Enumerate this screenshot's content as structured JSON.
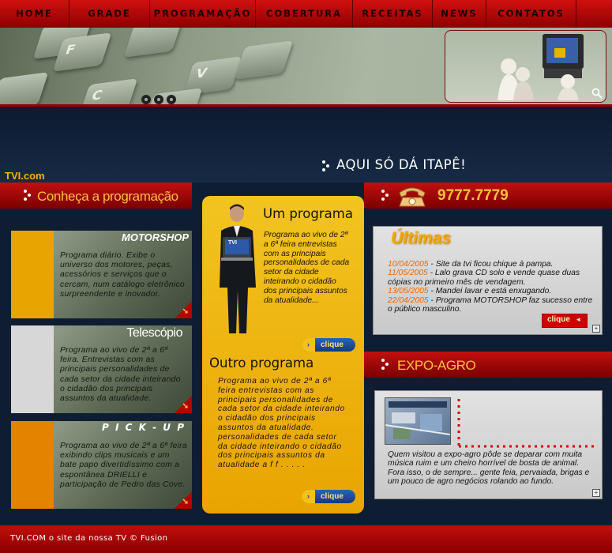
{
  "nav": {
    "items": [
      "HOME",
      "GRADE",
      "PROGRAMAÇÃO",
      "COBERTURA",
      "RECEITAS",
      "NEWS",
      "CONTATOS"
    ]
  },
  "banner": {
    "keys": [
      "F",
      "C",
      "V"
    ],
    "tagline": "AQUI SÓ DÁ ITAPÊ!",
    "logo": "TVI.com"
  },
  "left": {
    "section_title": "Conheça a programação",
    "cards": [
      {
        "title": "MOTORSHOP",
        "text": "Programa diário. Exibe o universo dos motores, peças, acessórios e serviços que o cercam, num catálogo eletrônico surpreendente e inovador.",
        "color": "#e8a400"
      },
      {
        "title": "Telescópio",
        "text": "Programa ao vivo de 2ª a 6ª feira. Entrevistas com as principais personalidades de cada setor da cidade inteirando o cidadão dos principais assuntos da atualidade.",
        "color": "#d7d7d7"
      },
      {
        "title": "P I C K - U P",
        "text": "Programa ao vivo de 2ª a 6ª feira exibindo clips musicais e um bate papo divertidíssimo com a espontânea DRIELLI e participação de Pedro das Cove.",
        "color": "#e38400"
      }
    ]
  },
  "center": {
    "program1_title": "Um programa",
    "program1_text": "Programa ao vivo de 2ª a 6ª feira entrevistas com as principais personalidades de cada setor da cidade inteirando o cidadão dos principais assuntos da atualidade...",
    "program2_title": "Outro programa",
    "program2_text": "Programa ao vivo de 2ª a 6ª feira entrevistas com as principais personalidades de cada setor da cidade inteirando o cidadão dos principais assuntos da atualidade. personalidades de cada setor da cidade inteirando o cidadão dos principais assuntos da atualidade a f f . . . . .",
    "button_label": "clique",
    "laptop_logo": "TVI"
  },
  "right": {
    "phone": "9777.7779",
    "ultimas_title": "Últimas",
    "news": [
      {
        "date": "10/04/2005",
        "text": " - Site da tvi ficou chique à pampa."
      },
      {
        "date": "11/05/2005",
        "text": " - Lalo grava CD solo e vende quase duas cópias no primeiro mês de vendagem."
      },
      {
        "date": "13/05/2005",
        "text": " - Mandei lavar e está enxugando."
      },
      {
        "date": "22/04/2005",
        "text": " - Programa MOTORSHOP  faz sucesso entre o público masculino."
      }
    ],
    "news_button": "clique",
    "expo_title": "EXPO-AGRO",
    "expo_text": "Quem visitou a expo-agro pôde se deparar com muita música ruim e um cheiro horrível de bosta de animal. Fora isso, o de sempre... gente feia, pervaiada, brigas e um pouco de agro negócios rolando ao fundo."
  },
  "footer": {
    "text": "TVI.COM o site da nossa TV © Fusion"
  },
  "colors": {
    "red": "#c30f0f",
    "gold": "#f5c23a",
    "navy": "#0f1d33",
    "date_orange": "#e06a10"
  }
}
